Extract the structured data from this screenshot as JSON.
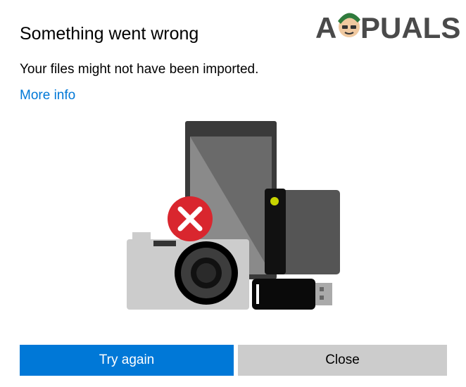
{
  "watermark": {
    "text_prefix": "A",
    "text_suffix": "PUALS"
  },
  "dialog": {
    "title": "Something went wrong",
    "message": "Your files might not have been imported.",
    "link_label": "More info",
    "primary_label": "Try again",
    "secondary_label": "Close"
  },
  "illustration": {
    "icons": [
      "tablet-icon",
      "hard-drive-icon",
      "camera-icon",
      "usb-drive-icon",
      "error-badge-icon"
    ]
  },
  "colors": {
    "accent": "#0078d7",
    "secondary_button": "#cccccc",
    "error": "#d9262e",
    "drive_led": "#c8d400"
  }
}
